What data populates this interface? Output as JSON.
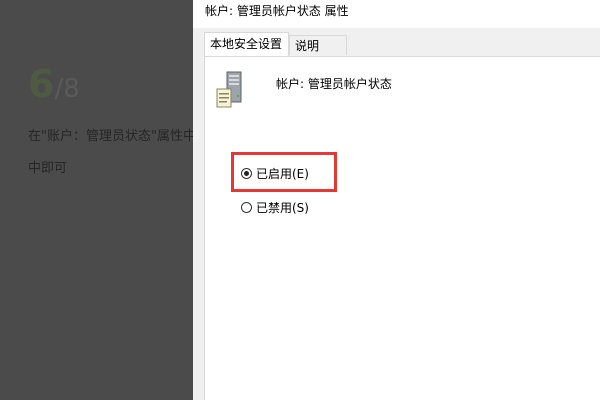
{
  "tutorial": {
    "step_current": "6",
    "step_separator": "/",
    "step_total": "8",
    "instruction": "在\"账户：管理员状态\"属性中…中即可"
  },
  "dialog": {
    "title": "帐户: 管理员帐户状态 属性",
    "tabs": [
      {
        "label": "本地安全设置",
        "active": true
      },
      {
        "label": "说明",
        "active": false
      }
    ],
    "policy_name": "帐户: 管理员帐户状态",
    "policy_icon": "server-icon",
    "options": [
      {
        "label": "已启用(E)",
        "checked": true
      },
      {
        "label": "已禁用(S)",
        "checked": false
      }
    ],
    "highlight_color": "#e53935"
  }
}
